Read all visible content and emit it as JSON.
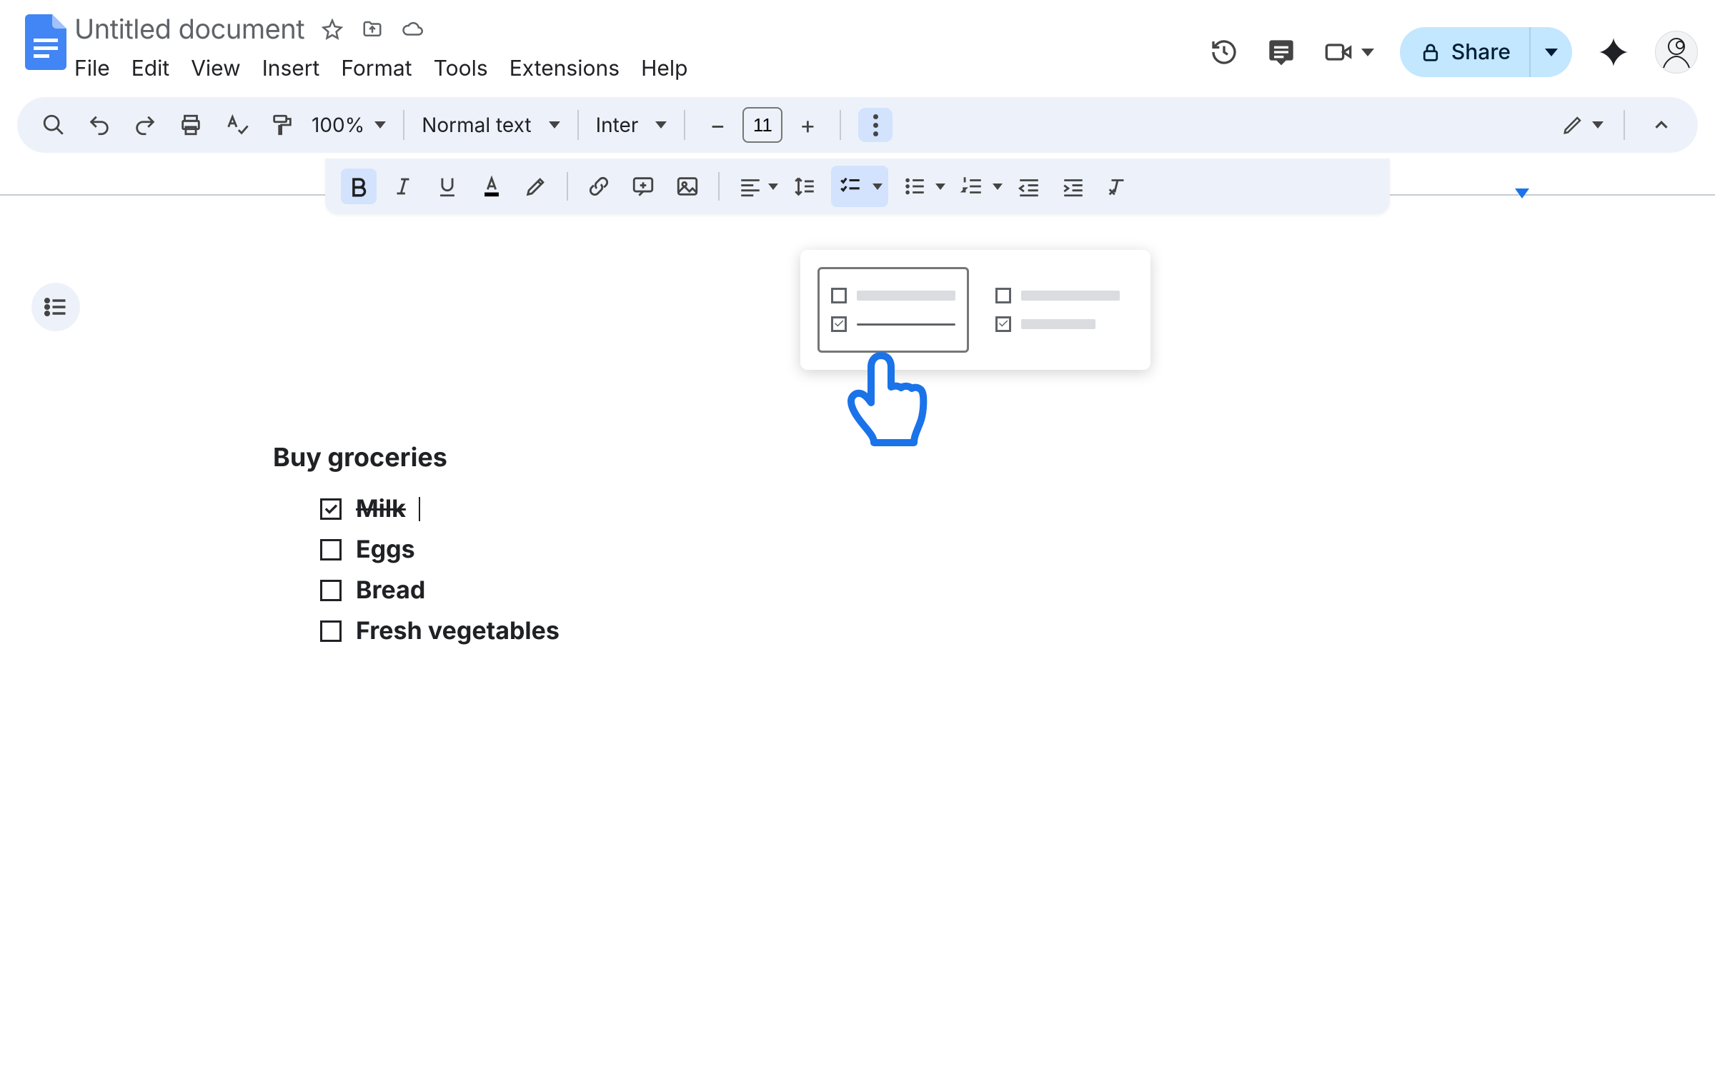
{
  "header": {
    "doc_title": "Untitled document",
    "menus": [
      "File",
      "Edit",
      "View",
      "Insert",
      "Format",
      "Tools",
      "Extensions",
      "Help"
    ],
    "share_label": "Share"
  },
  "toolbar": {
    "zoom": "100%",
    "paragraph_style": "Normal text",
    "font": "Inter",
    "font_size": "11"
  },
  "document": {
    "heading": "Buy groceries",
    "items": [
      {
        "text": "Milk",
        "checked": true
      },
      {
        "text": "Eggs",
        "checked": false
      },
      {
        "text": "Bread",
        "checked": false
      },
      {
        "text": "Fresh vegetables",
        "checked": false
      }
    ]
  }
}
